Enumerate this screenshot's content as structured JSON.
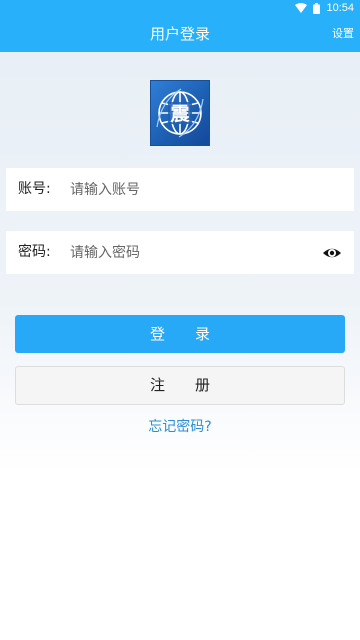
{
  "status_bar": {
    "time": "10:54",
    "icons": [
      "wifi-icon",
      "battery-icon"
    ]
  },
  "app_bar": {
    "title": "用户登录",
    "settings_label": "设置"
  },
  "logo": {
    "glyph": "震"
  },
  "account_field": {
    "label": "账号:",
    "placeholder": "请输入账号",
    "value": ""
  },
  "password_field": {
    "label": "密码:",
    "placeholder": "请输入密码",
    "value": "",
    "toggle_icon": "eye-icon"
  },
  "login_button": {
    "label": "登录"
  },
  "register_button": {
    "label": "注册"
  },
  "forgot_password": {
    "label": "忘记密码?"
  },
  "colors": {
    "primary": "#29b0fb",
    "button_primary": "#27a9f8",
    "link": "#2a8fd8",
    "logo_blue": "#1d5fb2"
  }
}
